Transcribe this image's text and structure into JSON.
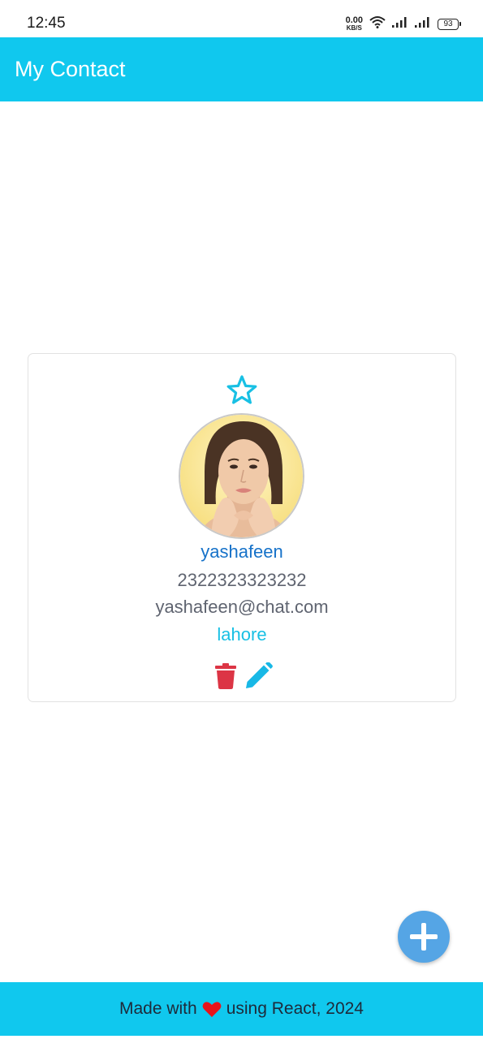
{
  "status_bar": {
    "time": "12:45",
    "net_speed_value": "0.00",
    "net_speed_unit": "KB/S",
    "battery": "93",
    "icons": [
      "wifi-icon",
      "signal-icon",
      "signal-icon",
      "battery-icon"
    ]
  },
  "app_bar": {
    "title": "My Contact"
  },
  "contact": {
    "favorite_icon": "star-outline-icon",
    "name": "yashafeen",
    "phone": "2322323323232",
    "email": "yashafeen@chat.com",
    "city": "lahore",
    "actions": {
      "delete_icon": "trash-icon",
      "edit_icon": "pencil-icon"
    }
  },
  "fab": {
    "icon": "plus-icon"
  },
  "footer": {
    "text_before": "Made with",
    "heart_icon": "heart-icon",
    "text_after": "using React, 2024"
  },
  "colors": {
    "primary": "#10c8ee",
    "name": "#1672c9",
    "muted": "#5f6470",
    "city": "#18c0e4",
    "delete": "#dc3545",
    "edit": "#18b8e6",
    "fab": "#55a5e5",
    "heart": "#e8141a"
  }
}
